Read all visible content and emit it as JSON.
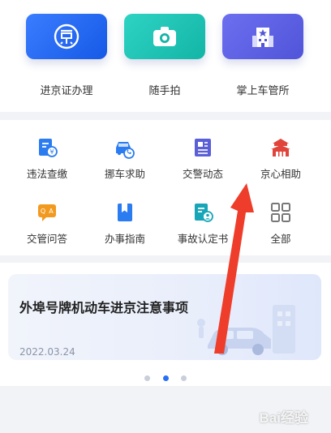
{
  "quick_tiles": [
    {
      "label": "进京证办理",
      "icon": "jing-badge-icon"
    },
    {
      "label": "随手拍",
      "icon": "camera-icon"
    },
    {
      "label": "掌上车管所",
      "icon": "building-icon"
    }
  ],
  "services": [
    {
      "label": "违法查缴",
      "icon": "violation-payment-icon",
      "color": "#2a7cf0"
    },
    {
      "label": "挪车求助",
      "icon": "car-phone-icon",
      "color": "#2a7cf0"
    },
    {
      "label": "交警动态",
      "icon": "news-icon",
      "color": "#5a5fd8"
    },
    {
      "label": "京心相助",
      "icon": "tiananmen-icon",
      "color": "#e0443a"
    },
    {
      "label": "交管问答",
      "icon": "qa-chat-icon",
      "color": "#f29a1f"
    },
    {
      "label": "办事指南",
      "icon": "guide-book-icon",
      "color": "#2a7cf0"
    },
    {
      "label": "事故认定书",
      "icon": "accident-document-icon",
      "color": "#17a6b8"
    },
    {
      "label": "全部",
      "icon": "grid-all-icon",
      "color": "#777777"
    }
  ],
  "banner": {
    "title": "外埠号牌机动车进京注意事项",
    "date": "2022.03.24"
  },
  "pagination": {
    "total": 3,
    "active": 2
  },
  "watermark": "Bai经验"
}
